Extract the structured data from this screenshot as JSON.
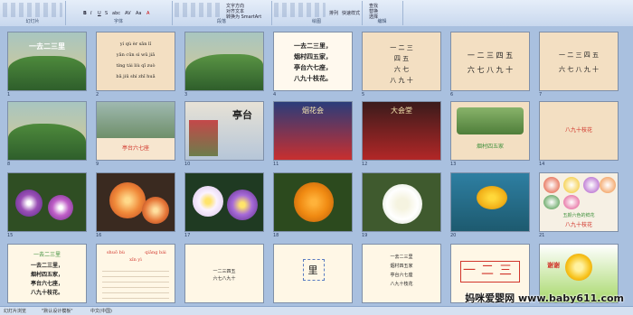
{
  "ribbon": {
    "groups": [
      {
        "label": "幻灯片",
        "items": [
          "新建",
          "幻灯片"
        ]
      },
      {
        "label": "字体",
        "items": [
          "B",
          "I",
          "U",
          "S",
          "abc",
          "AV",
          "Aa",
          "A"
        ]
      },
      {
        "label": "段落",
        "items": [
          "文字方向",
          "对齐文本",
          "转换为 SmartArt"
        ]
      },
      {
        "label": "绘图",
        "items": [
          "排列",
          "快速样式"
        ]
      },
      {
        "label": "编辑",
        "items": [
          "查找",
          "替换",
          "选择"
        ]
      }
    ]
  },
  "slides": [
    {
      "n": "1",
      "title": "一去二三里"
    },
    {
      "n": "2",
      "lines": [
        "yí qù èr sān lǐ",
        "yān cūn sì wǔ jiā",
        "tíng tái liù qī zuò",
        "bā jiǔ shí zhī huā"
      ]
    },
    {
      "n": "3",
      "title": ""
    },
    {
      "n": "4",
      "lines": [
        "一去二三里，",
        "烟村四五家，",
        "亭台六七座，",
        "八九十枝花。"
      ]
    },
    {
      "n": "5",
      "lines": [
        "一 二 三",
        "四 五",
        "六 七",
        "八 九 十"
      ]
    },
    {
      "n": "6",
      "lines": [
        "一 二 三 四 五",
        "六 七 八 九 十"
      ]
    },
    {
      "n": "7",
      "lines": [
        "一 二 三 四 五",
        "六 七 八 九 十"
      ]
    },
    {
      "n": "8",
      "title": ""
    },
    {
      "n": "9",
      "caption": "亭台六七座"
    },
    {
      "n": "10",
      "title": "亭台"
    },
    {
      "n": "11",
      "title": "烟花会"
    },
    {
      "n": "12",
      "title": "大会堂"
    },
    {
      "n": "13",
      "caption": "烟村四五家"
    },
    {
      "n": "14",
      "caption": "八九十枝花"
    },
    {
      "n": "15",
      "title": ""
    },
    {
      "n": "16",
      "title": ""
    },
    {
      "n": "17",
      "title": ""
    },
    {
      "n": "18",
      "title": ""
    },
    {
      "n": "19",
      "title": ""
    },
    {
      "n": "20",
      "title": ""
    },
    {
      "n": "21",
      "lines": [
        "五颜六色的鲜花",
        "八九十枝花"
      ]
    },
    {
      "n": "22",
      "lines": [
        "一去二三里",
        "一去二三里，",
        "烟村四五家，",
        "亭台六七座，",
        "八九十枝花。"
      ]
    },
    {
      "n": "23",
      "lines": [
        "shuō bù",
        "qiǎng bái",
        "xǐn yì"
      ]
    },
    {
      "n": "24",
      "lines": [
        "一二三四五",
        "六七八九十"
      ]
    },
    {
      "n": "25",
      "lines": [
        "里"
      ]
    },
    {
      "n": "26",
      "lines": [
        "一去二三里",
        "烟村四五家",
        "亭台六七座",
        "八九十枝花"
      ]
    },
    {
      "n": "27",
      "lines": [
        "一二三"
      ]
    },
    {
      "n": "28",
      "lines": [
        "谢谢"
      ]
    }
  ],
  "status": {
    "slide_info": "幻灯片浏览",
    "theme": "\"默认设计模板\"",
    "lang": "中文(中国)"
  },
  "watermark": "妈咪爱婴网 www.baby611.com",
  "colors": {
    "slide_bg": "#f3dfc2",
    "accent_red": "#d1352b",
    "accent_green": "#3d8f3a"
  }
}
